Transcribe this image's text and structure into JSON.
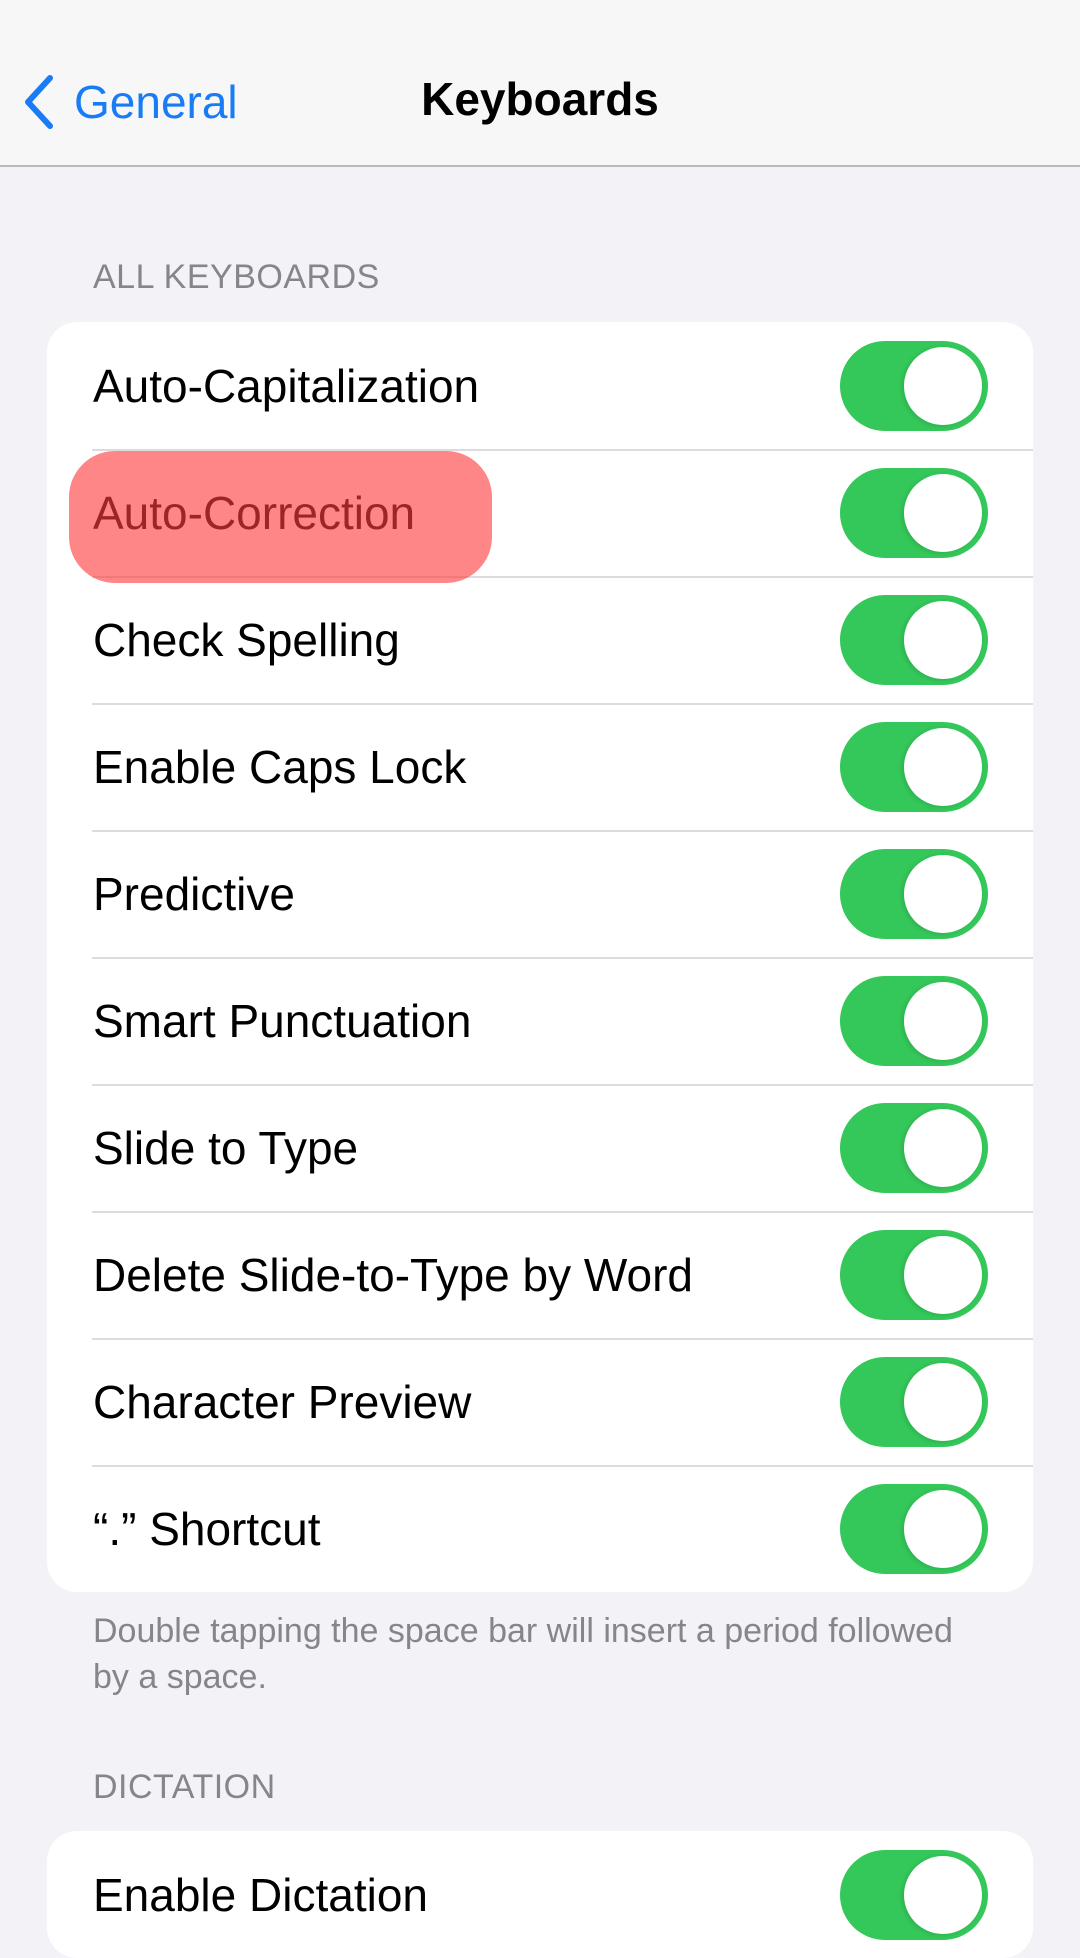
{
  "navbar": {
    "back_label": "General",
    "back_icon": "chevron-left-icon",
    "title": "Keyboards",
    "accent_color": "#1a7cf5"
  },
  "sections": [
    {
      "header": "ALL KEYBOARDS",
      "rows": [
        {
          "label": "Auto-Capitalization",
          "on": true
        },
        {
          "label": "Auto-Correction",
          "on": true,
          "highlighted": true
        },
        {
          "label": "Check Spelling",
          "on": true
        },
        {
          "label": "Enable Caps Lock",
          "on": true
        },
        {
          "label": "Predictive",
          "on": true
        },
        {
          "label": "Smart Punctuation",
          "on": true
        },
        {
          "label": "Slide to Type",
          "on": true
        },
        {
          "label": "Delete Slide-to-Type by Word",
          "on": true
        },
        {
          "label": "Character Preview",
          "on": true
        },
        {
          "label": "“.” Shortcut",
          "on": true
        }
      ],
      "footer": "Double tapping the space bar will insert a period followed by a space."
    },
    {
      "header": "DICTATION",
      "rows": [
        {
          "label": "Enable Dictation",
          "on": true
        }
      ]
    }
  ],
  "colors": {
    "toggle_on": "#34c759",
    "highlight": "#ff7f7f",
    "background": "#f2f2f7"
  }
}
